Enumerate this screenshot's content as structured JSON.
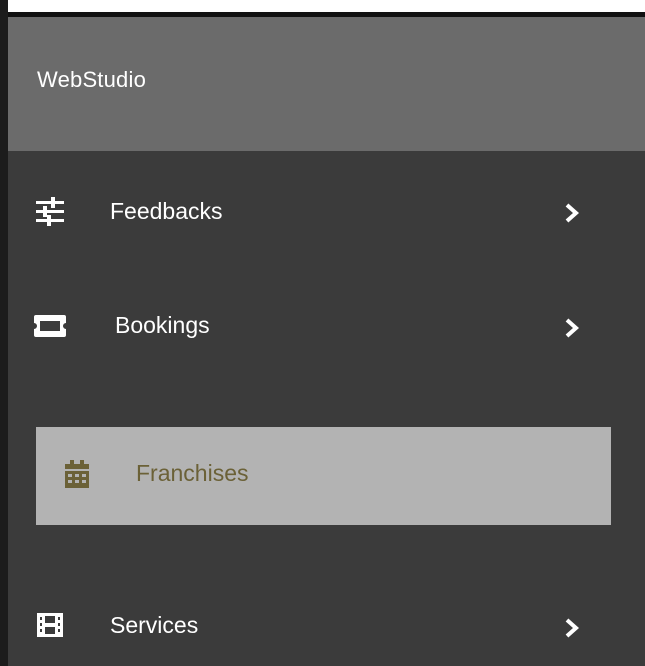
{
  "brand": {
    "title": "WebStudio"
  },
  "sidebar": {
    "items": [
      {
        "label": "Feedbacks",
        "icon": "sliders-icon",
        "has_submenu": true
      },
      {
        "label": "Bookings",
        "icon": "ticket-icon",
        "has_submenu": true
      },
      {
        "label": "Franchises",
        "icon": "calendar-icon",
        "has_submenu": false,
        "active": true
      },
      {
        "label": "Services",
        "icon": "film-icon",
        "has_submenu": true
      }
    ]
  },
  "colors": {
    "sidebar_bg": "#3b3b3b",
    "header_bg": "#6b6b6b",
    "active_bg": "#b3b3b3",
    "active_text": "#6b6137",
    "text": "#ffffff"
  }
}
